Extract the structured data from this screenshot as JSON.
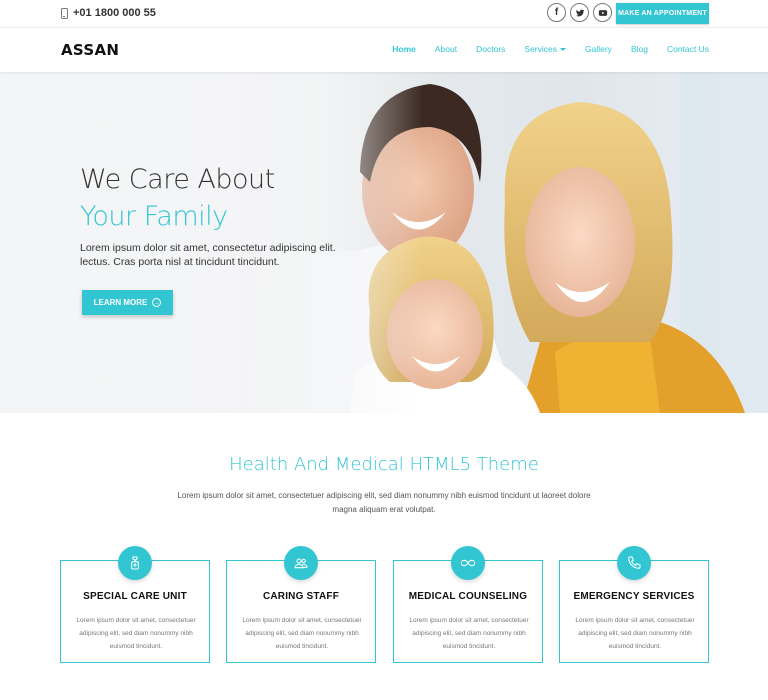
{
  "topbar": {
    "phone": "+01 1800 000 55",
    "socials": [
      {
        "icon": "facebook-icon",
        "glyph": "f"
      },
      {
        "icon": "twitter-icon",
        "glyph": ""
      },
      {
        "icon": "youtube-icon",
        "glyph": ""
      }
    ],
    "appointment_label": "MAKE AN APPOINTMENT"
  },
  "nav": {
    "logo": "ASSAN",
    "items": [
      {
        "label": "Home",
        "active": true
      },
      {
        "label": "About"
      },
      {
        "label": "Doctors"
      },
      {
        "label": "Services",
        "dropdown": true
      },
      {
        "label": "Gallery"
      },
      {
        "label": "Blog"
      },
      {
        "label": "Contact Us"
      }
    ]
  },
  "hero": {
    "title_line1": "We Care About",
    "title_line2": "Your Family",
    "description": "Lorem ipsum dolor sit amet, consectetur adipiscing elit. lectus. Cras porta nisl at tincidunt tincidunt.",
    "button_label": "LEARN MORE"
  },
  "intro": {
    "title": "Health And Medical HTML5 Theme",
    "text": "Lorem ipsum dolor sit amet, consectetuer adipiscing elit, sed diam nonummy nibh euismod tincidunt ut laoreet dolore magna aliquam erat volutpat."
  },
  "features": [
    {
      "icon": "medicine-icon",
      "title": "SPECIAL CARE UNIT",
      "text": "Lorem ipsum dolor sit amet, consectetuer adipiscing elit, sed diam nonummy nibh euismod tincidunt."
    },
    {
      "icon": "people-icon",
      "title": "CARING STAFF",
      "text": "Lorem ipsum dolor sit amet, consectetuer adipiscing elit, sed diam nonummy nibh euismod tincidunt."
    },
    {
      "icon": "infinity-icon",
      "title": "MEDICAL COUNSELING",
      "text": "Lorem ipsum dolor sit amet, consectetuer adipiscing elit, sed diam nonummy nibh euismod tincidunt."
    },
    {
      "icon": "phone-icon",
      "title": "EMERGENCY SERVICES",
      "text": "Lorem ipsum dolor sit amet, consectetuer adipiscing elit, sed diam nonummy nibh euismod tincidunt."
    }
  ],
  "colors": {
    "accent": "#32c5d2",
    "text": "#333333"
  }
}
